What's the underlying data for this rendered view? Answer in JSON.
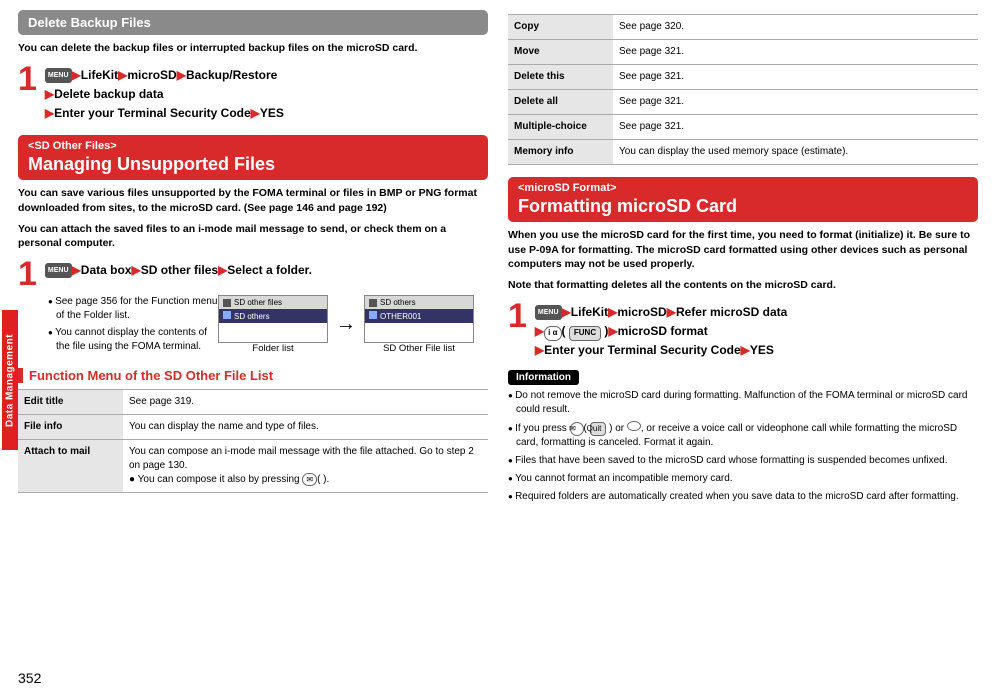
{
  "side_tab": "Data Management",
  "page_number": "352",
  "col1": {
    "h1": "Delete Backup Files",
    "intro1": "You can delete the backup files or interrupted backup files on the microSD card.",
    "step1": {
      "menu": "MENU",
      "path1a": "LifeKit",
      "path1b": "microSD",
      "path1c": "Backup/Restore",
      "path2": "Delete backup data",
      "path3a": "Enter your Terminal Security Code",
      "path3b": "YES"
    },
    "h2tag": "<SD Other Files>",
    "h2main": "Managing Unsupported Files",
    "intro2a": "You can save various files unsupported by the FOMA terminal or files in BMP or PNG format downloaded from sites, to the microSD card. (See page 146 and page 192)",
    "intro2b": "You can attach the saved files to an i-mode mail message to send, or check them on a personal computer.",
    "step2": {
      "menu": "MENU",
      "p1": "Data box",
      "p2": "SD other files",
      "p3": "Select a folder."
    },
    "bullets2": [
      "See page 356 for the Function menu of the Folder list.",
      "You cannot display the contents of the file using the FOMA terminal."
    ],
    "screen1": {
      "header": "SD other files",
      "line": "SD others"
    },
    "screen2": {
      "header": "SD others",
      "line": "OTHER001"
    },
    "cap1": "Folder list",
    "cap2": "SD Other File list",
    "funcmenu_title": "Function Menu of the SD Other File List",
    "table1": [
      {
        "k": "Edit title",
        "v": "See page 319."
      },
      {
        "k": "File info",
        "v": "You can display the name and type of files."
      },
      {
        "k": "Attach to mail",
        "v": "You can compose an i-mode mail message with the file attached. Go to step 2 on page 130.",
        "extra": "You can compose it also by pressing ",
        "keycap": "✉",
        "keycap2_blank": "(          )."
      }
    ]
  },
  "col2": {
    "table2": [
      {
        "k": "Copy",
        "v": "See page 320."
      },
      {
        "k": "Move",
        "v": "See page 321."
      },
      {
        "k": "Delete this",
        "v": "See page 321."
      },
      {
        "k": "Delete all",
        "v": "See page 321."
      },
      {
        "k": "Multiple-choice",
        "v": "See page 321."
      },
      {
        "k": "Memory info",
        "v": "You can display the used memory space (estimate)."
      }
    ],
    "h3tag": "<microSD Format>",
    "h3main": "Formatting microSD Card",
    "intro3a": "When you use the microSD card for the first time, you need to format (initialize) it. Be sure to use P-09A for formatting. The microSD card formatted using other devices such as personal computers may not be used properly.",
    "intro3b": "Note that formatting deletes all the contents on the microSD card.",
    "step3": {
      "menu": "MENU",
      "p1": "LifeKit",
      "p2": "microSD",
      "p3": "Refer microSD data",
      "k1": "i α",
      "k1label": "FUNC",
      "p4": "microSD format",
      "p5a": "Enter your Terminal Security Code",
      "p5b": "YES"
    },
    "info_title": "Information",
    "info": [
      "Do not remove the microSD card during formatting. Malfunction of the FOMA terminal or microSD card could result.",
      {
        "pre": "If you press ",
        "k1": "✉",
        "k1l": "Quit",
        "mid": " or ",
        "k2": "━",
        "post": ", or receive a voice call or videophone call while formatting the microSD card, formatting is canceled. Format it again."
      },
      "Files that have been saved to the microSD card whose formatting is suspended becomes unfixed.",
      "You cannot format an incompatible memory card.",
      "Required folders are automatically created when you save data to the microSD card after formatting."
    ]
  }
}
